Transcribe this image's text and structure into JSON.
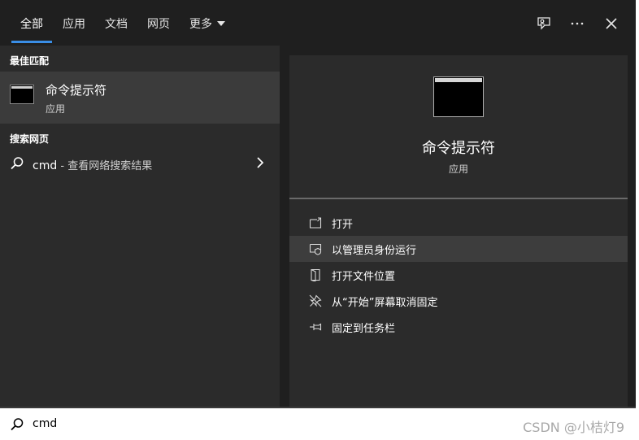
{
  "tabs": [
    {
      "label": "全部"
    },
    {
      "label": "应用"
    },
    {
      "label": "文档"
    },
    {
      "label": "网页"
    },
    {
      "label": "更多"
    }
  ],
  "left": {
    "best_match_heading": "最佳匹配",
    "best_match": {
      "title": "命令提示符",
      "subtitle": "应用"
    },
    "web_heading": "搜索网页",
    "web_result": {
      "query": "cmd",
      "desc": " - 查看网络搜索结果"
    }
  },
  "preview": {
    "title": "命令提示符",
    "subtitle": "应用",
    "actions": [
      {
        "label": "打开",
        "icon": "open-window-icon"
      },
      {
        "label": "以管理员身份运行",
        "icon": "run-as-admin-icon"
      },
      {
        "label": "打开文件位置",
        "icon": "file-location-icon"
      },
      {
        "label": "从“开始”屏幕取消固定",
        "icon": "unpin-icon"
      },
      {
        "label": "固定到任务栏",
        "icon": "pin-icon"
      }
    ]
  },
  "search": {
    "value": "cmd"
  },
  "watermark": "CSDN @小桔灯9",
  "colors": {
    "accent": "#3a8ee6",
    "pane": "#2b2b2b",
    "background": "#1f1f1f",
    "hover": "#3d3d3d"
  }
}
